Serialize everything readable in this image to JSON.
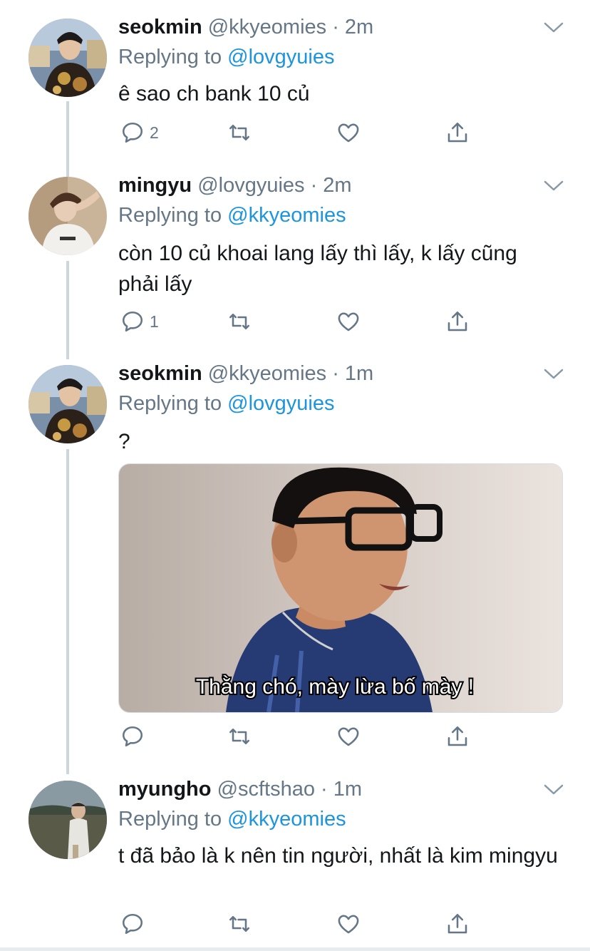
{
  "tweets": [
    {
      "name": "seokmin",
      "meta": "@kkyeomies · 2m",
      "replying_prefix": "Replying to",
      "replying_to": "@lovgyuies",
      "text": "ê sao ch bank 10 củ",
      "reply_count": "2",
      "avatar": "avatar-seokmin"
    },
    {
      "name": "mingyu",
      "meta": "@lovgyuies · 2m",
      "replying_prefix": "Replying to",
      "replying_to": "@kkyeomies",
      "text": "còn 10 củ khoai lang lấy thì lấy, k lấy cũng phải lấy",
      "reply_count": "1",
      "avatar": "avatar-mingyu"
    },
    {
      "name": "seokmin",
      "meta": "@kkyeomies · 1m",
      "replying_prefix": "Replying to",
      "replying_to": "@lovgyuies",
      "text": "?",
      "reply_count": "",
      "media_caption": "Thằng chó, mày lừa bố mày !",
      "avatar": "avatar-seokmin"
    },
    {
      "name": "myungho",
      "meta": "@scftshao · 1m",
      "replying_prefix": "Replying to",
      "replying_to": "@kkyeomies",
      "text": "t đã bảo là k nên tin người, nhất là kim mingyu",
      "reply_count": "",
      "avatar": "avatar-myungho"
    }
  ],
  "colors": {
    "name": "#14171a",
    "meta": "#657786",
    "mention": "#1b95e0",
    "thread_line": "#cdd5dd"
  }
}
